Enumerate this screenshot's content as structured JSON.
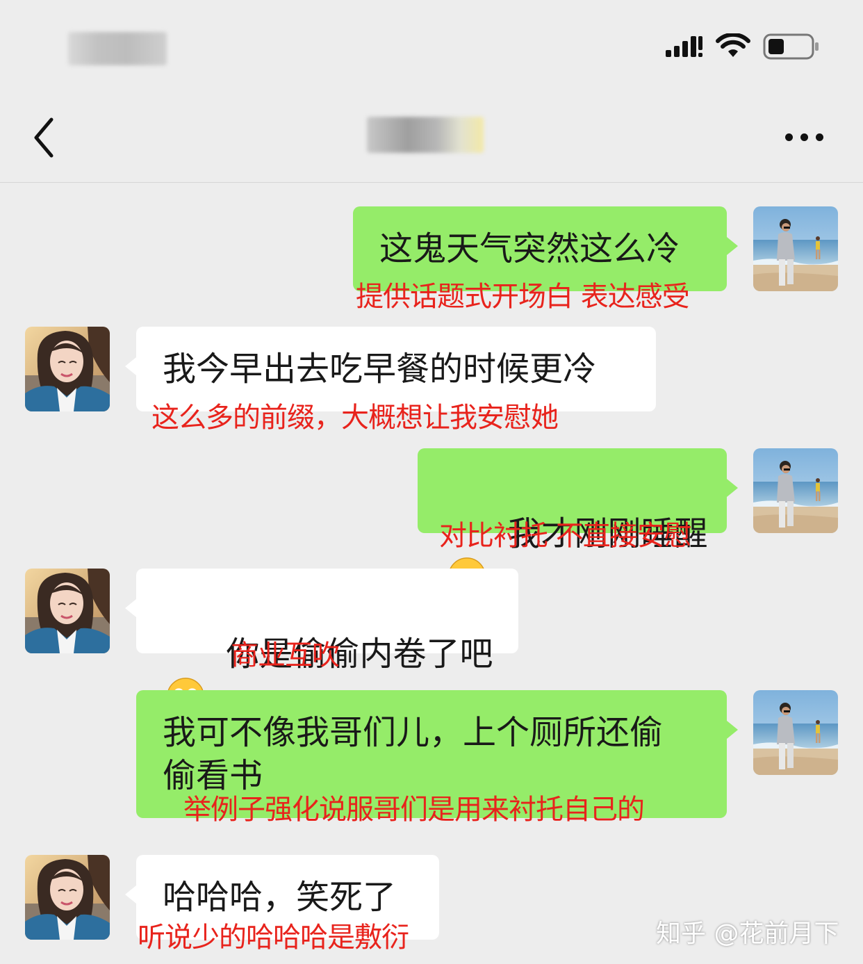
{
  "nav": {
    "back_icon": "chevron-left-icon",
    "more_icon": "more-dots-icon"
  },
  "messages": [
    {
      "sender": "me",
      "text": "这鬼天气突然这么冷",
      "note": "提供话题式开场白 表达感受"
    },
    {
      "sender": "them",
      "text": "我今早出去吃早餐的时候更冷",
      "note": "这么多的前缀，大概想让我安慰她"
    },
    {
      "sender": "me",
      "text": "我才刚刚睡醒",
      "emoji": "crying-laughing-emoji",
      "note": "对比衬托 不直接安慰"
    },
    {
      "sender": "them",
      "text": "你是偷偷内卷了吧",
      "emoji": "watermelon-eating-emoji",
      "note": "商业互吹"
    },
    {
      "sender": "me",
      "text": "我可不像我哥们儿，上个厕所还偷\n偷看书",
      "note": "举例子强化说服哥们是用来衬托自己的"
    },
    {
      "sender": "them",
      "text": "哈哈哈，笑死了",
      "note": "听说少的哈哈哈是敷衍"
    }
  ],
  "watermark": "知乎 @花前月下",
  "colors": {
    "my_bubble": "#95ec69",
    "their_bubble": "#ffffff",
    "annotation": "#e8231c",
    "background": "#ededed"
  }
}
